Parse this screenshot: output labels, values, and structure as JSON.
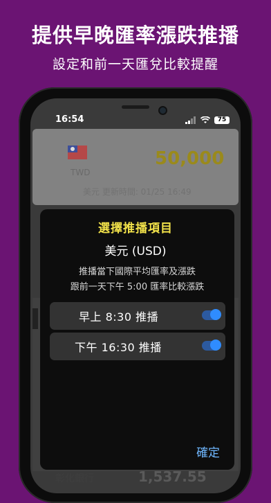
{
  "promo": {
    "headline": "提供早晚匯率漲跌推播",
    "subline": "設定和前一天匯兌比較提醒"
  },
  "status_bar": {
    "time": "16:54",
    "battery": "75"
  },
  "background": {
    "currency_code": "TWD",
    "amount": "50,000",
    "updated": "美元 更新時間: 01/25 16:49",
    "bank_name": "彰化銀行",
    "bank_value": "1,537.55"
  },
  "dialog": {
    "title": "選擇推播項目",
    "currency": "美元 (USD)",
    "desc_line1": "推播當下國際平均匯率及漲跌",
    "desc_line2": "跟前一天下午 5:00 匯率比較漲跌",
    "options": [
      {
        "label": "早上 8:30 推播",
        "enabled": true
      },
      {
        "label": "下午 16:30 推播",
        "enabled": true
      }
    ],
    "confirm_label": "確定"
  }
}
